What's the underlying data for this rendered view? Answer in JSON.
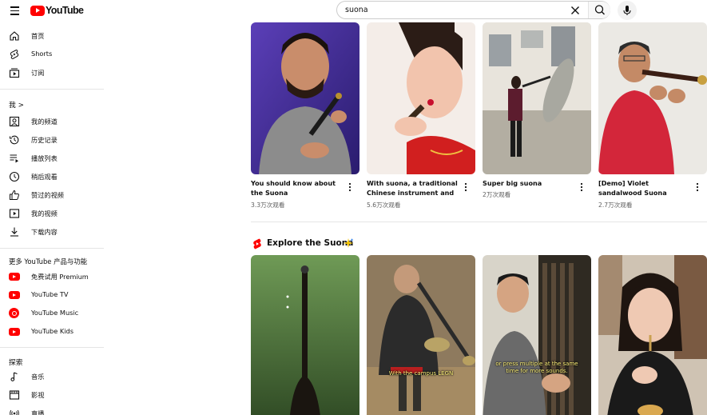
{
  "header": {
    "logo_text": "YouTube",
    "search_value": "suona"
  },
  "sidebar": {
    "main_items": [
      {
        "label": "首页",
        "icon": "home-icon"
      },
      {
        "label": "Shorts",
        "icon": "shorts-icon"
      },
      {
        "label": "订阅",
        "icon": "subscriptions-icon"
      }
    ],
    "you_title": "我 >",
    "you_items": [
      {
        "label": "我的频道",
        "icon": "channel-icon"
      },
      {
        "label": "历史记录",
        "icon": "history-icon"
      },
      {
        "label": "播放列表",
        "icon": "playlists-icon"
      },
      {
        "label": "稍后观看",
        "icon": "watch-later-icon"
      },
      {
        "label": "赞过的视频",
        "icon": "liked-icon"
      },
      {
        "label": "我的视频",
        "icon": "your-videos-icon"
      },
      {
        "label": "下载内容",
        "icon": "downloads-icon"
      }
    ],
    "more_title": "更多 YouTube 产品与功能",
    "more_items": [
      {
        "label": "免费试用 Premium",
        "icon": "youtube-premium-icon"
      },
      {
        "label": "YouTube TV",
        "icon": "youtube-tv-icon"
      },
      {
        "label": "YouTube Music",
        "icon": "youtube-music-icon"
      },
      {
        "label": "YouTube Kids",
        "icon": "youtube-kids-icon"
      }
    ],
    "explore_title": "探索",
    "explore_items": [
      {
        "label": "音乐",
        "icon": "music-icon"
      },
      {
        "label": "影视",
        "icon": "movies-icon"
      },
      {
        "label": "直播",
        "icon": "live-icon"
      }
    ]
  },
  "videos": [
    {
      "title": "You should know about the Suona",
      "views": "3.3万次观看"
    },
    {
      "title": "With suona, a traditional Chinese instrument and ...",
      "views": "5.6万次观看"
    },
    {
      "title": "Super big suona",
      "views": "2万次观看"
    },
    {
      "title": "[Demo] Violet sandalwood Suona",
      "views": "2.7万次观看"
    }
  ],
  "shelf": {
    "title": "Explore the Suona",
    "captions": [
      "With the campus LEGN",
      "or press multiple at the same time for more sounds."
    ]
  },
  "colors": {
    "brand_red": "#ff0000",
    "text": "#0f0f0f",
    "secondary": "#606060"
  }
}
